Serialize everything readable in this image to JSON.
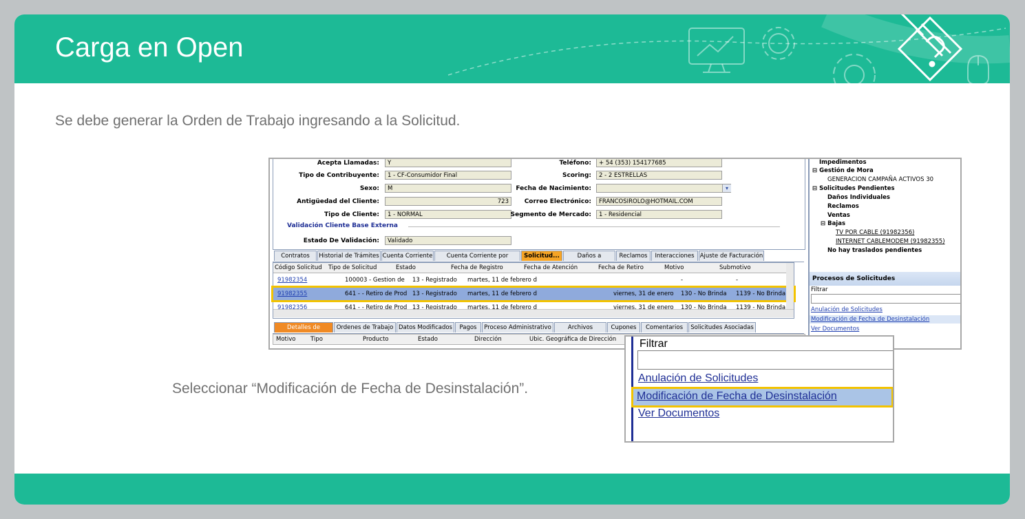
{
  "header": {
    "title": "Carga en Open"
  },
  "lead": "Se debe generar la Orden de Trabajo ingresando a la Solicitud.",
  "caption": "Seleccionar “Modificación de Fecha de Desinstalación”.",
  "colors": {
    "brand": "#1dba96",
    "highlight": "#f3c300",
    "selection": "#8faadc"
  },
  "form": {
    "acepta_llamadas_label": "Acepta Llamadas:",
    "acepta_llamadas": "Y",
    "telefono_label": "Teléfono:",
    "telefono": "+ 54 (353) 154177685",
    "tipo_contribuyente_label": "Tipo de Contribuyente:",
    "tipo_contribuyente": "1 - CF-Consumidor Final",
    "scoring_label": "Scoring:",
    "scoring": "2 - 2 ESTRELLAS",
    "sexo_label": "Sexo:",
    "sexo": "M",
    "fecha_nacimiento_label": "Fecha de Nacimiento:",
    "fecha_nacimiento": "",
    "antiguedad_label": "Antigüedad del Cliente:",
    "antiguedad": "723",
    "correo_label": "Correo Electrónico:",
    "correo": "FRANCOSIROLO@HOTMAIL.COM",
    "tipo_cliente_label": "Tipo de Cliente:",
    "tipo_cliente": "1 - NORMAL",
    "segmento_label": "Segmento de Mercado:",
    "segmento": "1 - Residencial",
    "section": "Validación Cliente Base Externa",
    "estado_validacion_label": "Estado De Validación:",
    "estado_validacion": "Validado"
  },
  "tabs_top": [
    "Contratos",
    "Historial de Trámites",
    "Cuenta Corriente",
    "Cuenta Corriente por Factura",
    "Solicitud...",
    "Daños a Producto",
    "Reclamos",
    "Interacciones",
    "Ajuste de Facturación"
  ],
  "grid": {
    "headers": [
      "Código Solicitud",
      "Tipo de Solicitud",
      "Estado",
      "Fecha de Registro",
      "Fecha de Atención",
      "Fecha de Retiro",
      "Motivo",
      "Submotivo"
    ],
    "rows": [
      {
        "codigo": "91982354",
        "tipo": "100003 - Gestion de",
        "estado": "13 - Registrado",
        "fecha_registro": "martes, 11 de febrero d",
        "fecha_retiro": "",
        "motivo": "-",
        "submotivo": "-"
      },
      {
        "codigo": "91982355",
        "tipo": "641 - - Retiro de Prod",
        "estado": "13 - Registrado",
        "fecha_registro": "martes, 11 de febrero d",
        "fecha_retiro": "viernes, 31 de enero",
        "motivo": "130 - No Brinda",
        "submotivo": "1139 - No Brinda"
      },
      {
        "codigo": "91982356",
        "tipo": "641 - - Retiro de Prod",
        "estado": "13 - Registrado",
        "fecha_registro": "martes, 11 de febrero d",
        "fecha_retiro": "viernes, 31 de enero",
        "motivo": "130 - No Brinda",
        "submotivo": "1139 - No Brinda"
      }
    ]
  },
  "tabs_bottom": [
    "Detalles de Solicitud",
    "Ordenes de Trabajo",
    "Datos Modificados",
    "Pagos",
    "Proceso Administrativo",
    "Archivos Adjuntos",
    "Cupones",
    "Comentarios",
    "Solicitudes Asociadas"
  ],
  "detail_headers": [
    "Motivo",
    "Tipo",
    "Producto",
    "Estado",
    "Dirección",
    "Ubic. Geográfica de Dirección"
  ],
  "tree": {
    "impedimentos": "Impedimentos",
    "gestion_mora": "Gestión de Mora",
    "campana": "GENERACION CAMPAÑA ACTIVOS 30",
    "pendientes": "Solicitudes Pendientes",
    "danos": "Daños Individuales",
    "reclamos": "Reclamos",
    "ventas": "Ventas",
    "bajas": "Bajas",
    "baja1": "TV POR CABLE (91982356)",
    "baja2": "INTERNET CABLEMODEM (91982355)",
    "traslados": "No hay traslados pendientes"
  },
  "procesos": {
    "title": "Procesos de Solicitudes",
    "filter_label": "Filtrar",
    "items": [
      "Anulación de Solicitudes",
      "Modificación de Fecha de Desinstalación",
      "Ver Documentos"
    ]
  }
}
